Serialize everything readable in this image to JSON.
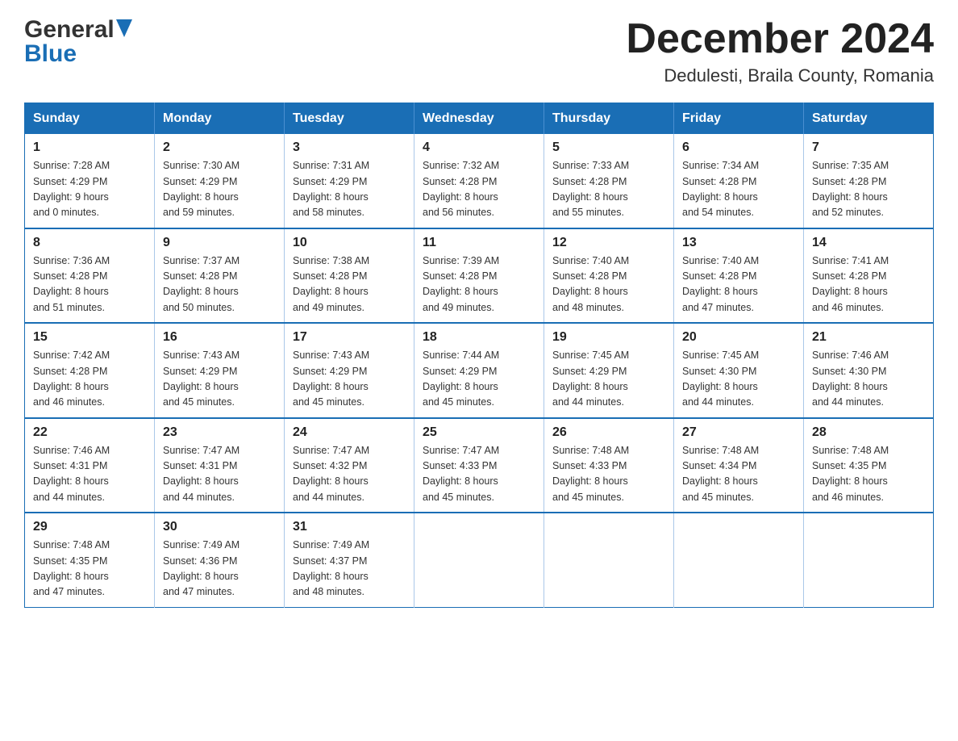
{
  "header": {
    "logo": {
      "general": "General",
      "blue": "Blue"
    },
    "title": "December 2024",
    "location": "Dedulesti, Braila County, Romania"
  },
  "calendar": {
    "days_of_week": [
      "Sunday",
      "Monday",
      "Tuesday",
      "Wednesday",
      "Thursday",
      "Friday",
      "Saturday"
    ],
    "weeks": [
      [
        {
          "day": "1",
          "sunrise": "Sunrise: 7:28 AM",
          "sunset": "Sunset: 4:29 PM",
          "daylight": "Daylight: 9 hours",
          "daylight2": "and 0 minutes."
        },
        {
          "day": "2",
          "sunrise": "Sunrise: 7:30 AM",
          "sunset": "Sunset: 4:29 PM",
          "daylight": "Daylight: 8 hours",
          "daylight2": "and 59 minutes."
        },
        {
          "day": "3",
          "sunrise": "Sunrise: 7:31 AM",
          "sunset": "Sunset: 4:29 PM",
          "daylight": "Daylight: 8 hours",
          "daylight2": "and 58 minutes."
        },
        {
          "day": "4",
          "sunrise": "Sunrise: 7:32 AM",
          "sunset": "Sunset: 4:28 PM",
          "daylight": "Daylight: 8 hours",
          "daylight2": "and 56 minutes."
        },
        {
          "day": "5",
          "sunrise": "Sunrise: 7:33 AM",
          "sunset": "Sunset: 4:28 PM",
          "daylight": "Daylight: 8 hours",
          "daylight2": "and 55 minutes."
        },
        {
          "day": "6",
          "sunrise": "Sunrise: 7:34 AM",
          "sunset": "Sunset: 4:28 PM",
          "daylight": "Daylight: 8 hours",
          "daylight2": "and 54 minutes."
        },
        {
          "day": "7",
          "sunrise": "Sunrise: 7:35 AM",
          "sunset": "Sunset: 4:28 PM",
          "daylight": "Daylight: 8 hours",
          "daylight2": "and 52 minutes."
        }
      ],
      [
        {
          "day": "8",
          "sunrise": "Sunrise: 7:36 AM",
          "sunset": "Sunset: 4:28 PM",
          "daylight": "Daylight: 8 hours",
          "daylight2": "and 51 minutes."
        },
        {
          "day": "9",
          "sunrise": "Sunrise: 7:37 AM",
          "sunset": "Sunset: 4:28 PM",
          "daylight": "Daylight: 8 hours",
          "daylight2": "and 50 minutes."
        },
        {
          "day": "10",
          "sunrise": "Sunrise: 7:38 AM",
          "sunset": "Sunset: 4:28 PM",
          "daylight": "Daylight: 8 hours",
          "daylight2": "and 49 minutes."
        },
        {
          "day": "11",
          "sunrise": "Sunrise: 7:39 AM",
          "sunset": "Sunset: 4:28 PM",
          "daylight": "Daylight: 8 hours",
          "daylight2": "and 49 minutes."
        },
        {
          "day": "12",
          "sunrise": "Sunrise: 7:40 AM",
          "sunset": "Sunset: 4:28 PM",
          "daylight": "Daylight: 8 hours",
          "daylight2": "and 48 minutes."
        },
        {
          "day": "13",
          "sunrise": "Sunrise: 7:40 AM",
          "sunset": "Sunset: 4:28 PM",
          "daylight": "Daylight: 8 hours",
          "daylight2": "and 47 minutes."
        },
        {
          "day": "14",
          "sunrise": "Sunrise: 7:41 AM",
          "sunset": "Sunset: 4:28 PM",
          "daylight": "Daylight: 8 hours",
          "daylight2": "and 46 minutes."
        }
      ],
      [
        {
          "day": "15",
          "sunrise": "Sunrise: 7:42 AM",
          "sunset": "Sunset: 4:28 PM",
          "daylight": "Daylight: 8 hours",
          "daylight2": "and 46 minutes."
        },
        {
          "day": "16",
          "sunrise": "Sunrise: 7:43 AM",
          "sunset": "Sunset: 4:29 PM",
          "daylight": "Daylight: 8 hours",
          "daylight2": "and 45 minutes."
        },
        {
          "day": "17",
          "sunrise": "Sunrise: 7:43 AM",
          "sunset": "Sunset: 4:29 PM",
          "daylight": "Daylight: 8 hours",
          "daylight2": "and 45 minutes."
        },
        {
          "day": "18",
          "sunrise": "Sunrise: 7:44 AM",
          "sunset": "Sunset: 4:29 PM",
          "daylight": "Daylight: 8 hours",
          "daylight2": "and 45 minutes."
        },
        {
          "day": "19",
          "sunrise": "Sunrise: 7:45 AM",
          "sunset": "Sunset: 4:29 PM",
          "daylight": "Daylight: 8 hours",
          "daylight2": "and 44 minutes."
        },
        {
          "day": "20",
          "sunrise": "Sunrise: 7:45 AM",
          "sunset": "Sunset: 4:30 PM",
          "daylight": "Daylight: 8 hours",
          "daylight2": "and 44 minutes."
        },
        {
          "day": "21",
          "sunrise": "Sunrise: 7:46 AM",
          "sunset": "Sunset: 4:30 PM",
          "daylight": "Daylight: 8 hours",
          "daylight2": "and 44 minutes."
        }
      ],
      [
        {
          "day": "22",
          "sunrise": "Sunrise: 7:46 AM",
          "sunset": "Sunset: 4:31 PM",
          "daylight": "Daylight: 8 hours",
          "daylight2": "and 44 minutes."
        },
        {
          "day": "23",
          "sunrise": "Sunrise: 7:47 AM",
          "sunset": "Sunset: 4:31 PM",
          "daylight": "Daylight: 8 hours",
          "daylight2": "and 44 minutes."
        },
        {
          "day": "24",
          "sunrise": "Sunrise: 7:47 AM",
          "sunset": "Sunset: 4:32 PM",
          "daylight": "Daylight: 8 hours",
          "daylight2": "and 44 minutes."
        },
        {
          "day": "25",
          "sunrise": "Sunrise: 7:47 AM",
          "sunset": "Sunset: 4:33 PM",
          "daylight": "Daylight: 8 hours",
          "daylight2": "and 45 minutes."
        },
        {
          "day": "26",
          "sunrise": "Sunrise: 7:48 AM",
          "sunset": "Sunset: 4:33 PM",
          "daylight": "Daylight: 8 hours",
          "daylight2": "and 45 minutes."
        },
        {
          "day": "27",
          "sunrise": "Sunrise: 7:48 AM",
          "sunset": "Sunset: 4:34 PM",
          "daylight": "Daylight: 8 hours",
          "daylight2": "and 45 minutes."
        },
        {
          "day": "28",
          "sunrise": "Sunrise: 7:48 AM",
          "sunset": "Sunset: 4:35 PM",
          "daylight": "Daylight: 8 hours",
          "daylight2": "and 46 minutes."
        }
      ],
      [
        {
          "day": "29",
          "sunrise": "Sunrise: 7:48 AM",
          "sunset": "Sunset: 4:35 PM",
          "daylight": "Daylight: 8 hours",
          "daylight2": "and 47 minutes."
        },
        {
          "day": "30",
          "sunrise": "Sunrise: 7:49 AM",
          "sunset": "Sunset: 4:36 PM",
          "daylight": "Daylight: 8 hours",
          "daylight2": "and 47 minutes."
        },
        {
          "day": "31",
          "sunrise": "Sunrise: 7:49 AM",
          "sunset": "Sunset: 4:37 PM",
          "daylight": "Daylight: 8 hours",
          "daylight2": "and 48 minutes."
        },
        null,
        null,
        null,
        null
      ]
    ]
  }
}
